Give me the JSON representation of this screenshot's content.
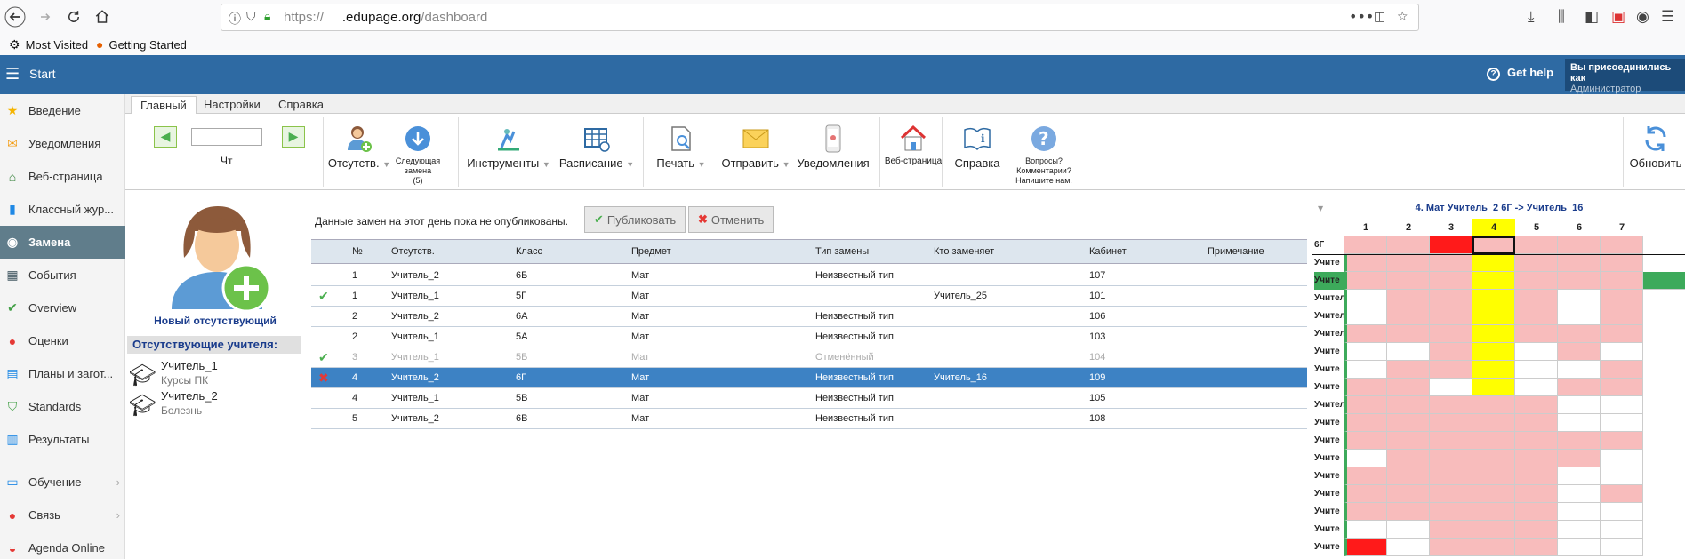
{
  "browser": {
    "url_prefix": "https://",
    "url_domain": ".edupage.org",
    "url_path": "/dashboard",
    "bookmarks": [
      "Most Visited",
      "Getting Started"
    ]
  },
  "topbar": {
    "start": "Start",
    "help": "Get help",
    "user_line1": "Вы присоединились как",
    "user_line2": "Администратор"
  },
  "sidebar": {
    "items": [
      {
        "label": "Введение",
        "icon": "star-icon",
        "color": "#f5b400"
      },
      {
        "label": "Уведомления",
        "icon": "envelope-icon",
        "color": "#f39c12"
      },
      {
        "label": "Веб-страница",
        "icon": "home-icon",
        "color": "#2e7d32"
      },
      {
        "label": "Классный жур...",
        "icon": "book-icon",
        "color": "#1e88e5"
      },
      {
        "label": "Замена",
        "icon": "user-icon",
        "color": "#ffffff"
      },
      {
        "label": "События",
        "icon": "calendar-icon",
        "color": "#455a64"
      },
      {
        "label": "Overview",
        "icon": "check-circle-icon",
        "color": "#43a047"
      },
      {
        "label": "Оценки",
        "icon": "grade-icon",
        "color": "#e53935"
      },
      {
        "label": "Планы и загот...",
        "icon": "plans-icon",
        "color": "#1e88e5"
      },
      {
        "label": "Standards",
        "icon": "shield-icon",
        "color": "#43a047"
      },
      {
        "label": "Результаты",
        "icon": "bar-chart-icon",
        "color": "#1e88e5"
      },
      {
        "label": "Обучение",
        "icon": "education-icon",
        "color": "#1e88e5"
      },
      {
        "label": "Связь",
        "icon": "chat-icon",
        "color": "#e53935"
      },
      {
        "label": "Agenda Online",
        "icon": "agenda-icon",
        "color": "#e53935"
      }
    ]
  },
  "tabs": [
    "Главный",
    "Настройки",
    "Справка"
  ],
  "ribbon": {
    "day": "Чт",
    "absent": "Отсутств.",
    "next_line1": "Следующая",
    "next_line2": "замена",
    "next_line3": "(5)",
    "tools": "Инструменты",
    "schedule": "Расписание",
    "print": "Печать",
    "send": "Отправить",
    "notifications": "Уведомления",
    "webpage": "Веб-страница",
    "help": "Справка",
    "questions_line1": "Вопросы?",
    "questions_line2": "Комментарии?",
    "questions_line3": "Напишите нам.",
    "refresh": "Обновить"
  },
  "left": {
    "new_absent": "Новый отсутствующий",
    "absent_header": "Отсутствующие учителя:",
    "teachers": [
      {
        "name": "Учитель_1",
        "reason": "Курсы ПК"
      },
      {
        "name": "Учитель_2",
        "reason": "Болезнь"
      }
    ]
  },
  "main": {
    "notice": "Данные замен на этот день пока не опубликованы.",
    "publish": "Публиковать",
    "cancel": "Отменить",
    "headers": [
      "№",
      "Отсутств.",
      "Класс",
      "Предмет",
      "Тип замены",
      "Кто заменяет",
      "Кабинет",
      "Примечание"
    ],
    "rows": [
      {
        "mark": "",
        "num": "1",
        "absent": "Учитель_2",
        "class": "6Б",
        "subject": "Мат",
        "type": "Неизвестный тип",
        "sub": "",
        "room": "107",
        "note": ""
      },
      {
        "mark": "check",
        "num": "1",
        "absent": "Учитель_1",
        "class": "5Г",
        "subject": "Мат",
        "type": "",
        "sub": "Учитель_25",
        "room": "101",
        "note": ""
      },
      {
        "mark": "",
        "num": "2",
        "absent": "Учитель_2",
        "class": "6А",
        "subject": "Мат",
        "type": "Неизвестный тип",
        "sub": "",
        "room": "106",
        "note": ""
      },
      {
        "mark": "",
        "num": "2",
        "absent": "Учитель_1",
        "class": "5А",
        "subject": "Мат",
        "type": "Неизвестный тип",
        "sub": "",
        "room": "103",
        "note": ""
      },
      {
        "mark": "check",
        "num": "3",
        "absent": "Учитель_1",
        "class": "5Б",
        "subject": "Мат",
        "type": "Отменённый",
        "sub": "",
        "room": "104",
        "note": "",
        "state": "gray"
      },
      {
        "mark": "x",
        "num": "4",
        "absent": "Учитель_2",
        "class": "6Г",
        "subject": "Мат",
        "type": "Неизвестный тип",
        "sub": "Учитель_16",
        "room": "109",
        "note": "",
        "state": "sel"
      },
      {
        "mark": "",
        "num": "4",
        "absent": "Учитель_1",
        "class": "5В",
        "subject": "Мат",
        "type": "Неизвестный тип",
        "sub": "",
        "room": "105",
        "note": ""
      },
      {
        "mark": "",
        "num": "5",
        "absent": "Учитель_2",
        "class": "6В",
        "subject": "Мат",
        "type": "Неизвестный тип",
        "sub": "",
        "room": "108",
        "note": ""
      }
    ]
  },
  "right": {
    "title": "4. Мат Учитель_2 6Г -> Учитель_16",
    "periods": [
      "1",
      "2",
      "3",
      "4",
      "5",
      "6",
      "7"
    ],
    "row_labels": [
      "6Г",
      "Учите",
      "Учите",
      "Учител",
      "Учител",
      "Учител",
      "Учите",
      "Учите",
      "Учите",
      "Учител",
      "Учите",
      "Учите",
      "Учите",
      "Учите",
      "Учите",
      "Учите",
      "Учите",
      "Учите"
    ],
    "grid": [
      "pprPPPP",
      "pppyppp",
      "pppypppg",
      "wppypwp",
      "wppypwp",
      "pppyppp",
      "wwpywpw",
      "wppywwp",
      "ppwywpp",
      "pppppww",
      "pppppww",
      "ppppppp",
      "wpppppw",
      "pppppww",
      "pppppwp",
      "pppppww",
      "wwpppww",
      "Rwpppww"
    ]
  }
}
